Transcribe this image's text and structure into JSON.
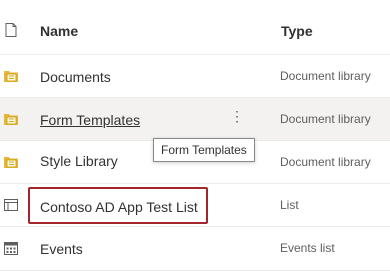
{
  "header": {
    "name_label": "Name",
    "type_label": "Type",
    "icon": "file-type-icon"
  },
  "rows": [
    {
      "name": "Documents",
      "type": "Document library",
      "icon": "document-library-icon"
    },
    {
      "name": "Form Templates",
      "type": "Document library",
      "icon": "document-library-icon",
      "more_icon": "more-vertical-icon"
    },
    {
      "name": "Style Library",
      "type": "Document library",
      "icon": "document-library-icon"
    },
    {
      "name": "Contoso AD App Test List",
      "type": "List",
      "icon": "list-icon"
    },
    {
      "name": "Events",
      "type": "Events list",
      "icon": "calendar-icon"
    }
  ],
  "tooltip": {
    "text": "Form Templates"
  },
  "more_glyph": "⋮",
  "colors": {
    "highlight_border": "#a4262c",
    "hover_row": "#f3f2f1",
    "library_icon": "#c19c00"
  }
}
